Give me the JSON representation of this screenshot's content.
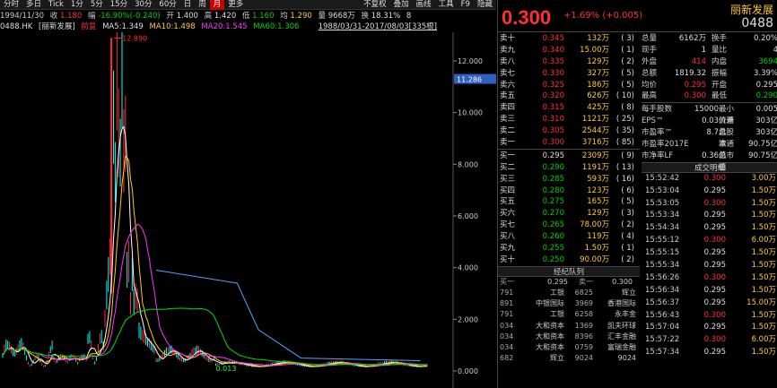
{
  "toolbar": {
    "items": [
      "分时",
      "多日",
      "Tick",
      "1分",
      "5分",
      "15分",
      "30分",
      "60分",
      "日",
      "周",
      "月",
      "更多"
    ],
    "active_index": 10,
    "right_items": [
      "不复权",
      "叠加",
      "画线",
      "工具",
      "F9",
      "隐藏"
    ]
  },
  "infobar": {
    "date": "1994/11/30",
    "close_label": "收",
    "close": "1.180",
    "range_label": "幅",
    "range": "-16.90%(-0.240)",
    "open_label": "开",
    "open": "1.400",
    "high_label": "高",
    "high": "1.420",
    "low_label": "低",
    "low": "1.160",
    "avg_label": "均",
    "avg": "1.290",
    "vol_label": "量",
    "vol": "9668万",
    "turnover_label": "换",
    "turnover": "18.31%",
    "more": "8"
  },
  "mabar": {
    "code": "0488.HK",
    "name": "[丽新发展]",
    "adj": "前复",
    "ma5": "MA5:1.349",
    "ma10": "MA10:1.498",
    "ma20": "MA20:1.545",
    "ma60": "MA60:1.306",
    "range": "1988/03/31-2017/08/03[335根]"
  },
  "chart_data": {
    "type": "line",
    "yticks": [
      "12.000",
      "10.000",
      "8.000",
      "6.000",
      "4.000",
      "2.000",
      "0.000"
    ],
    "current_price_label": "11.286",
    "max_label": "12.890",
    "min_label": "0.013",
    "colors": {
      "ma5": "#ffffff",
      "ma10": "#ffcc00",
      "ma20": "#ff33ff",
      "ma60": "#00dd00",
      "candle_up": "#ff3030",
      "candle_down": "#00ffff"
    }
  },
  "quote": {
    "price": "0.300",
    "change": "+1.69% (+0.005)",
    "name": "丽新发展",
    "code": "0488"
  },
  "asks": [
    {
      "label": "卖十",
      "price": "0.345",
      "vol": "132万",
      "n": "( 3)"
    },
    {
      "label": "卖九",
      "price": "0.340",
      "vol": "15.00万",
      "n": "( 1)"
    },
    {
      "label": "卖八",
      "price": "0.335",
      "vol": "129万",
      "n": "( 2)"
    },
    {
      "label": "卖七",
      "price": "0.330",
      "vol": "327万",
      "n": "( 5)"
    },
    {
      "label": "卖六",
      "price": "0.325",
      "vol": "186万",
      "n": "( 5)"
    },
    {
      "label": "卖五",
      "price": "0.320",
      "vol": "626万",
      "n": "( 10)"
    },
    {
      "label": "卖四",
      "price": "0.315",
      "vol": "425万",
      "n": "( 8)"
    },
    {
      "label": "卖三",
      "price": "0.310",
      "vol": "1121万",
      "n": "( 25)"
    },
    {
      "label": "卖二",
      "price": "0.305",
      "vol": "2544万",
      "n": "( 35)"
    },
    {
      "label": "卖一",
      "price": "0.300",
      "vol": "3716万",
      "n": "( 85)"
    }
  ],
  "bids": [
    {
      "label": "买一",
      "price": "0.295",
      "vol": "2309万",
      "n": "( 9)"
    },
    {
      "label": "买二",
      "price": "0.290",
      "vol": "1191万",
      "n": "( 13)"
    },
    {
      "label": "买三",
      "price": "0.285",
      "vol": "593万",
      "n": "( 16)"
    },
    {
      "label": "买四",
      "price": "0.280",
      "vol": "123万",
      "n": "( 6)"
    },
    {
      "label": "买五",
      "price": "0.275",
      "vol": "165万",
      "n": "( 5)"
    },
    {
      "label": "买六",
      "price": "0.270",
      "vol": "129万",
      "n": "( 3)"
    },
    {
      "label": "买七",
      "price": "0.265",
      "vol": "78.00万",
      "n": "( 2)"
    },
    {
      "label": "买八",
      "price": "0.260",
      "vol": "119万",
      "n": "( 4)"
    },
    {
      "label": "买九",
      "price": "0.255",
      "vol": "1.50万",
      "n": "( 1)"
    },
    {
      "label": "买十",
      "price": "0.250",
      "vol": "90.00万",
      "n": "( 2)"
    }
  ],
  "broker": {
    "title": "经纪队列",
    "head": {
      "side": "买一",
      "price": "0.295",
      "side2": "卖一",
      "price2": "0.300"
    },
    "rows": [
      {
        "c1": "791",
        "n1": "工银",
        "c2": "6825",
        "n2": "辉立"
      },
      {
        "c1": "891",
        "n1": "中银国际",
        "c2": "3969",
        "n2": "香港国际"
      },
      {
        "c1": "791",
        "n1": "工银",
        "c2": "6258",
        "n2": "永丰金"
      },
      {
        "c1": "034",
        "n1": "大和资本",
        "c2": "1369",
        "n2": "凯夫环球"
      },
      {
        "c1": "034",
        "n1": "大和资本",
        "c2": "8396",
        "n2": "汇丰金融"
      },
      {
        "c1": "034",
        "n1": "大和资本",
        "c2": "0759",
        "n2": "富瑞金融"
      },
      {
        "c1": "682",
        "n1": "辉立",
        "c2": "9024",
        "n2": "9024"
      }
    ]
  },
  "stats": [
    {
      "k": "总量",
      "v": "6162万",
      "k2": "换手",
      "v2": "0.20%"
    },
    {
      "k": "现手",
      "v": "1",
      "k2": "量比",
      "v2": "4"
    },
    {
      "k": "外盘",
      "v": "414",
      "k2": "内盘",
      "v2": "3694"
    },
    {
      "k": "总额",
      "v": "1819.32",
      "k2": "振幅",
      "v2": "3.39%"
    },
    {
      "k": "均价",
      "v": "0.295",
      "k2": "开盘",
      "v2": "0.295"
    },
    {
      "k": "最高",
      "v": "0.300",
      "k2": "最低",
      "v2": "0.290"
    }
  ],
  "stats2": [
    {
      "k": "每手股数",
      "v": "15000",
      "k2": "最小价差",
      "v2": "0.005"
    },
    {
      "k": "EPS™",
      "v": "0.03",
      "k2": "流通盘",
      "v2": "303亿"
    },
    {
      "k": "市盈率™",
      "v": "8.7",
      "k2": "总股本",
      "v2": "303亿"
    },
    {
      "k": "市盈率2017E",
      "v": "",
      "k2": "流通值",
      "v2": "90.75亿"
    },
    {
      "k": "市净率LF",
      "v": "0.36",
      "k2": "总市值",
      "v2": "90.75亿"
    }
  ],
  "ticks": {
    "title": "成交明细",
    "rows": [
      {
        "t": "15:52:42",
        "p": "0.300",
        "v": "3.00万"
      },
      {
        "t": "15:53:04",
        "p": "0.295",
        "v": "1.50万"
      },
      {
        "t": "15:53:05",
        "p": "0.300",
        "v": "1.50万"
      },
      {
        "t": "15:53:34",
        "p": "0.295",
        "v": "1.50万"
      },
      {
        "t": "15:54:34",
        "p": "0.295",
        "v": "1.50万"
      },
      {
        "t": "15:55:12",
        "p": "0.300",
        "v": "6.00万"
      },
      {
        "t": "15:55:15",
        "p": "0.295",
        "v": "1.50万"
      },
      {
        "t": "15:55:34",
        "p": "0.295",
        "v": "1.50万"
      },
      {
        "t": "15:56:26",
        "p": "0.300",
        "v": "1.50万"
      },
      {
        "t": "15:56:34",
        "p": "0.295",
        "v": "1.50万"
      },
      {
        "t": "15:56:37",
        "p": "0.295",
        "v": "15.00万"
      },
      {
        "t": "15:56:43",
        "p": "0.300",
        "v": "1.50万"
      },
      {
        "t": "15:57:04",
        "p": "0.295",
        "v": "1.50万"
      },
      {
        "t": "15:57:22",
        "p": "0.300",
        "v": "6.00万"
      },
      {
        "t": "15:57:34",
        "p": "0.295",
        "v": "1.50万"
      }
    ]
  }
}
